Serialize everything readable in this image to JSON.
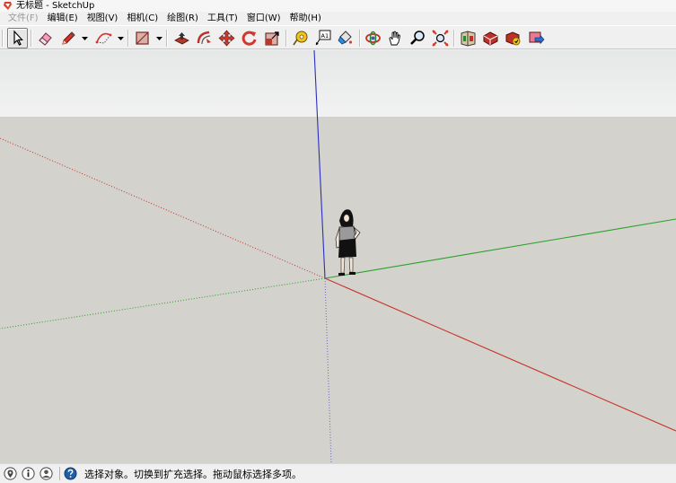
{
  "window": {
    "title": "无标题 - SketchUp"
  },
  "menu": {
    "items": [
      {
        "label": "文件(F)",
        "enabled": false
      },
      {
        "label": "编辑(E)",
        "enabled": true
      },
      {
        "label": "视图(V)",
        "enabled": true
      },
      {
        "label": "相机(C)",
        "enabled": true
      },
      {
        "label": "绘图(R)",
        "enabled": true
      },
      {
        "label": "工具(T)",
        "enabled": true
      },
      {
        "label": "窗口(W)",
        "enabled": true
      },
      {
        "label": "帮助(H)",
        "enabled": true
      }
    ]
  },
  "toolbar": {
    "tools": [
      {
        "name": "select",
        "icon": "arrow-cursor-icon",
        "active": true
      },
      {
        "name": "eraser",
        "icon": "eraser-icon"
      },
      {
        "name": "line",
        "icon": "pencil-icon",
        "has_dropdown": true
      },
      {
        "name": "arc",
        "icon": "arc-icon",
        "has_dropdown": true
      },
      {
        "name": "shape",
        "icon": "rectangle-icon",
        "has_dropdown": true
      },
      {
        "name": "push-pull",
        "icon": "push-pull-icon"
      },
      {
        "name": "offset",
        "icon": "offset-icon"
      },
      {
        "name": "move",
        "icon": "move-icon"
      },
      {
        "name": "rotate",
        "icon": "rotate-icon"
      },
      {
        "name": "scale",
        "icon": "scale-icon"
      },
      {
        "name": "tape-measure",
        "icon": "tape-measure-icon"
      },
      {
        "name": "text",
        "icon": "text-label-icon"
      },
      {
        "name": "paint-bucket",
        "icon": "paint-bucket-icon"
      },
      {
        "name": "orbit",
        "icon": "orbit-icon"
      },
      {
        "name": "pan",
        "icon": "hand-icon"
      },
      {
        "name": "zoom",
        "icon": "magnifier-icon"
      },
      {
        "name": "zoom-extents",
        "icon": "zoom-extents-icon"
      },
      {
        "name": "warehouse",
        "icon": "3d-warehouse-icon"
      },
      {
        "name": "extension-warehouse",
        "icon": "extension-warehouse-icon"
      },
      {
        "name": "share-model",
        "icon": "share-model-icon"
      },
      {
        "name": "send-to-layout",
        "icon": "send-to-layout-icon"
      }
    ],
    "text_tool_label": "A1"
  },
  "viewport": {
    "sky_color": "#eef0ef",
    "ground_color": "#d3d2cc",
    "axis_colors": {
      "red": "#c8322a",
      "green": "#2aa12a",
      "blue": "#2b2fbf"
    }
  },
  "status": {
    "icons": [
      "geo-location-icon",
      "credits-icon",
      "user-account-icon",
      "help-icon"
    ],
    "message": "选择对象。切换到扩充选择。拖动鼠标选择多项。"
  }
}
